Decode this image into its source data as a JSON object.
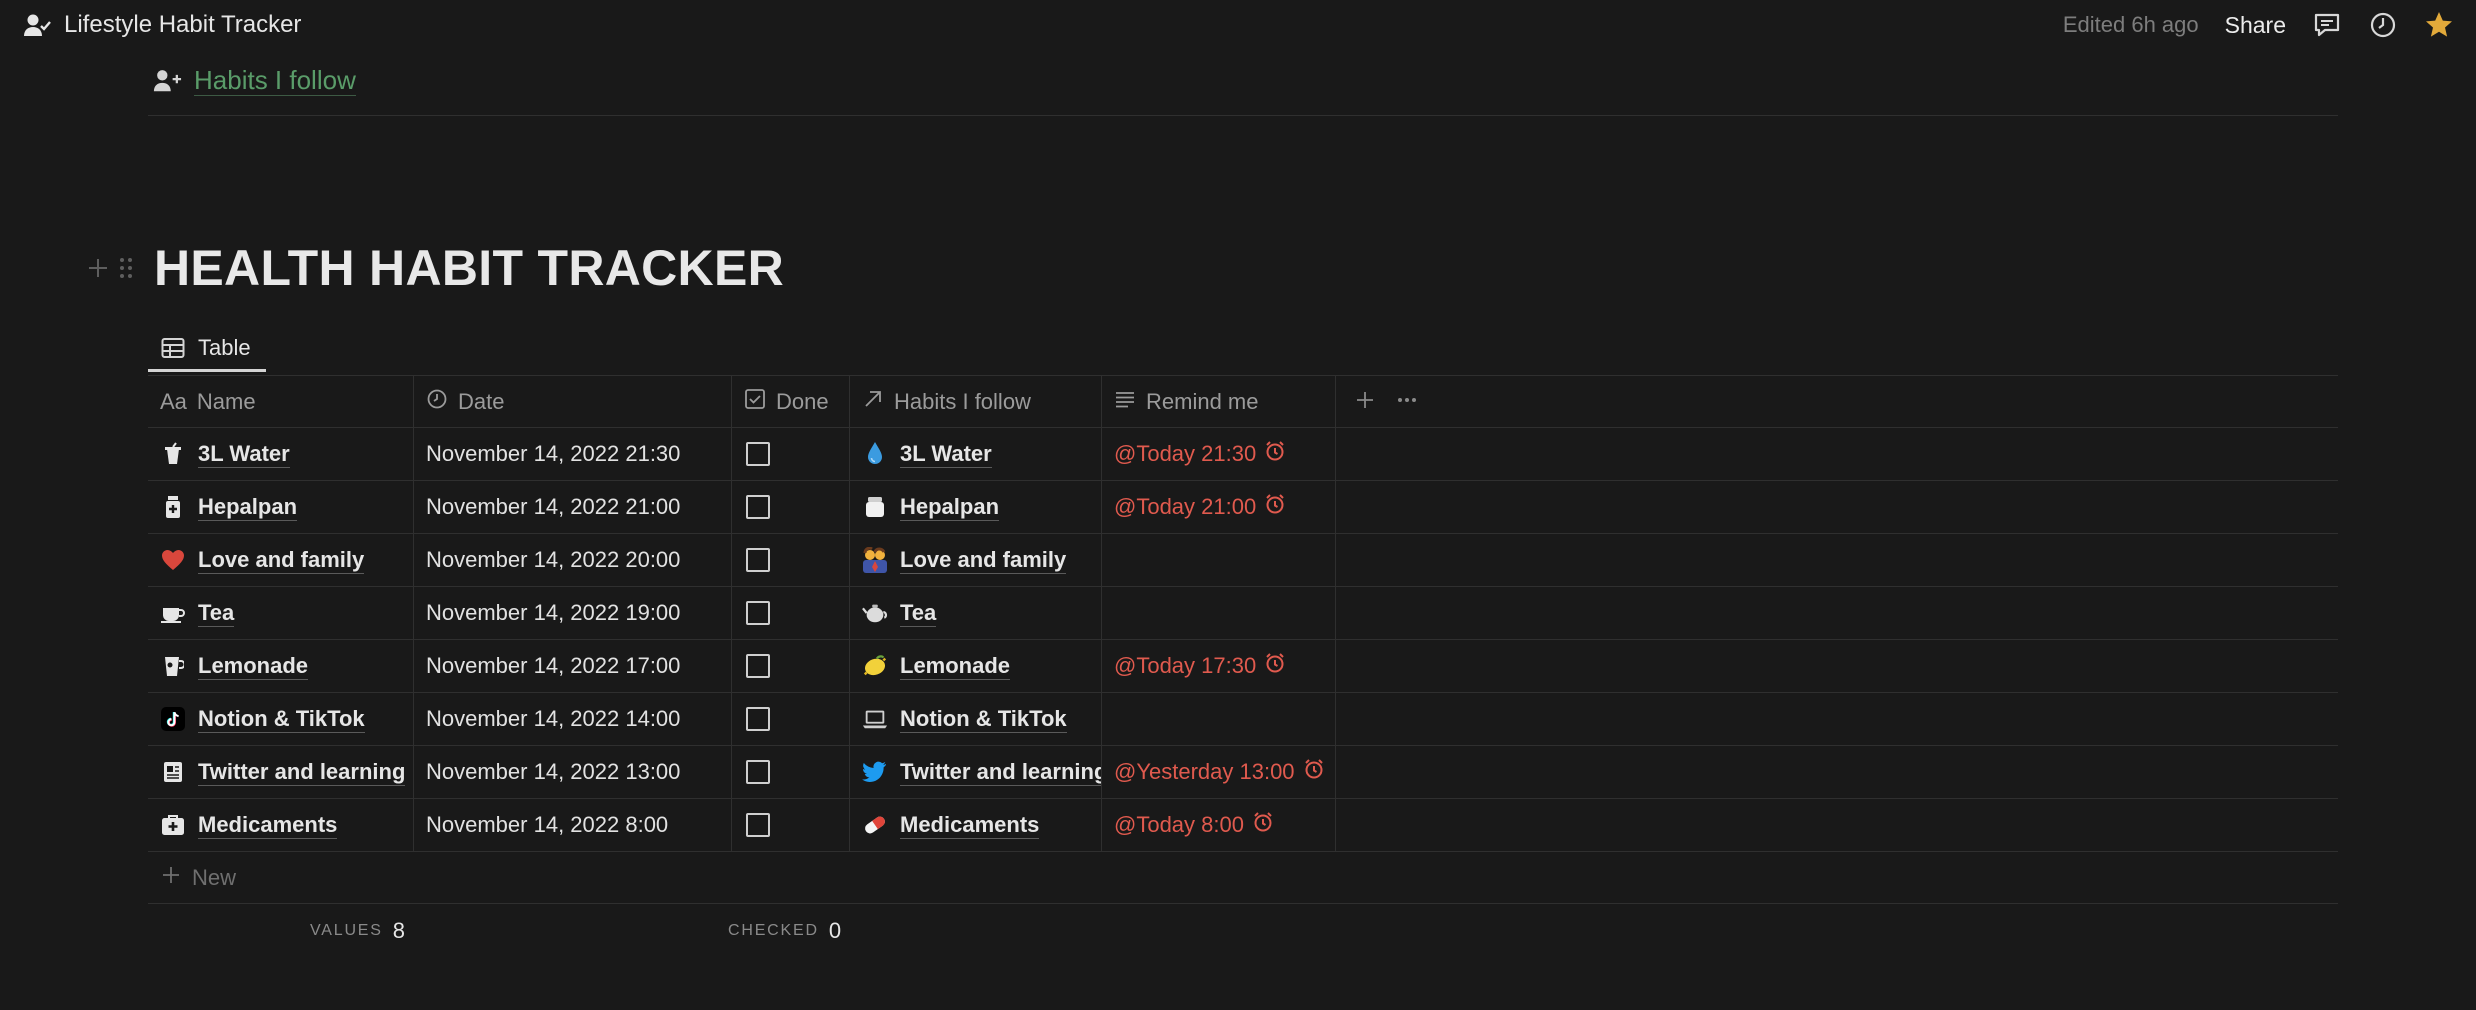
{
  "topbar": {
    "title": "Lifestyle Habit Tracker",
    "edited": "Edited 6h ago",
    "share_label": "Share",
    "icons": [
      "comment-icon",
      "clock-icon",
      "star-icon"
    ],
    "star_color": "#e2a93a"
  },
  "link": {
    "label": "Habits I follow"
  },
  "heading": "HEALTH HABIT TRACKER",
  "view_tab": {
    "label": "Table"
  },
  "columns": {
    "name": {
      "prefix": "Aa",
      "label": "Name"
    },
    "date": "Date",
    "done": "Done",
    "habits": "Habits I follow",
    "remind": "Remind me"
  },
  "rows": [
    {
      "icon": "cup-icon",
      "name": "3L Water",
      "date": "November 14, 2022 21:30",
      "done": false,
      "habit_icon": "droplet-icon",
      "habit": "3L Water",
      "remind": "@Today 21:30"
    },
    {
      "icon": "medicine-bottle-icon",
      "name": "Hepalpan",
      "date": "November 14, 2022 21:00",
      "done": false,
      "habit_icon": "jar-icon",
      "habit": "Hepalpan",
      "remind": "@Today 21:00"
    },
    {
      "icon": "heart-icon",
      "name": "Love and family",
      "date": "November 14, 2022 20:00",
      "done": false,
      "habit_icon": "family-icon",
      "habit": "Love and family",
      "remind": ""
    },
    {
      "icon": "tea-cup-icon",
      "name": "Tea",
      "date": "November 14, 2022 19:00",
      "done": false,
      "habit_icon": "teapot-icon",
      "habit": "Tea",
      "remind": ""
    },
    {
      "icon": "glass-icon",
      "name": "Lemonade",
      "date": "November 14, 2022 17:00",
      "done": false,
      "habit_icon": "lemon-icon",
      "habit": "Lemonade",
      "remind": "@Today 17:30"
    },
    {
      "icon": "tiktok-icon",
      "name": "Notion & TikTok",
      "date": "November 14, 2022 14:00",
      "done": false,
      "habit_icon": "laptop-icon",
      "habit": "Notion & TikTok",
      "remind": ""
    },
    {
      "icon": "newspaper-icon",
      "name": "Twitter and learning",
      "date": "November 14, 2022 13:00",
      "done": false,
      "habit_icon": "bird-icon",
      "habit": "Twitter and learning",
      "remind": "@Yesterday 13:00"
    },
    {
      "icon": "first-aid-icon",
      "name": "Medicaments",
      "date": "November 14, 2022 8:00",
      "done": false,
      "habit_icon": "pill-icon",
      "habit": "Medicaments",
      "remind": "@Today 8:00"
    }
  ],
  "new_label": "New",
  "footer": {
    "values_label": "VALUES",
    "values_count": "8",
    "checked_label": "CHECKED",
    "checked_count": "0"
  },
  "colors": {
    "background": "#191919",
    "link_green": "#5a9c69",
    "remind_red": "#e05a4e"
  }
}
